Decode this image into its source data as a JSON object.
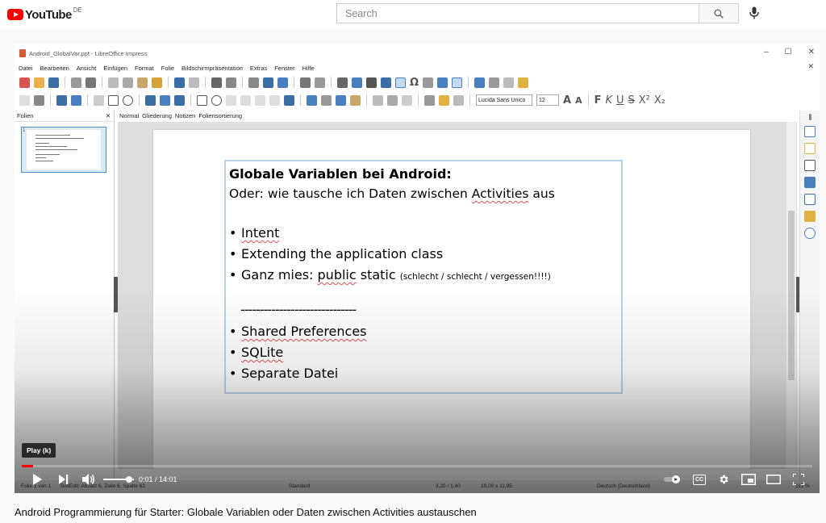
{
  "youtube": {
    "logo_text": "YouTube",
    "country_code": "DE",
    "search_placeholder": "Search",
    "icons": [
      "search-icon",
      "mic-icon"
    ]
  },
  "libreoffice": {
    "window_title": "Android_GlobalVar.ppt - LibreOffice Impress",
    "menu": [
      "Datei",
      "Bearbeiten",
      "Ansicht",
      "Einfügen",
      "Format",
      "Folie",
      "Bildschirmpräsentation",
      "Extras",
      "Fenster",
      "Hilfe"
    ],
    "font_name": "Lucida Sans Unico",
    "font_size": "12",
    "slides_pane_title": "Folien",
    "slide_number": "1",
    "view_tabs": [
      "Normal",
      "Gliederung",
      "Notizen",
      "Foliensortierung"
    ],
    "toolbar_text_buttons": {
      "bold": "F",
      "italic": "K",
      "underline": "U",
      "strike": "S",
      "superscript": "X²",
      "subscript": "X₂",
      "special_char": "Ω",
      "grow_font": "A",
      "shrink_font": "A"
    },
    "status": {
      "slide": "Folie 1 von 1",
      "textedit": "TextEdit: Absatz 6, Zeile 6, Spalte 62",
      "layout": "Standard",
      "position": "3,20 / 1,40",
      "size": "19,00 x 11,95",
      "language": "Deutsch (Deutschland)",
      "zoom": "115 %"
    }
  },
  "slide": {
    "title": "Globale Variablen bei Android:",
    "subtitle_before": "Oder: wie tausche ich Daten zwischen ",
    "subtitle_underlined": "Activities",
    "subtitle_after": " aus",
    "item1": "Intent",
    "item2": "Extending the application class",
    "item3_before": "Ganz mies: ",
    "item3_underlined": "public",
    "item3_after": " static ",
    "item3_small": "(schlecht / schlecht / vergessen!!!!)",
    "divider": "------------------------------",
    "item4_underlined": "Shared Preferences",
    "item5_underlined": "SQLite",
    "item6": "Separate Datei",
    "bullet": "•"
  },
  "player": {
    "tooltip": "Play (k)",
    "time": "0:01 / 14:01",
    "progress_fraction": 0.002,
    "volume_fraction": 0.85,
    "cc_label": "CC"
  },
  "video_title": "Android Programmierung für Starter: Globale Variablen oder Daten zwischen Activities austauschen",
  "colors": {
    "youtube_red": "#ff0000",
    "selection_border": "#b9d2ea",
    "spellcheck": "#e05050"
  }
}
